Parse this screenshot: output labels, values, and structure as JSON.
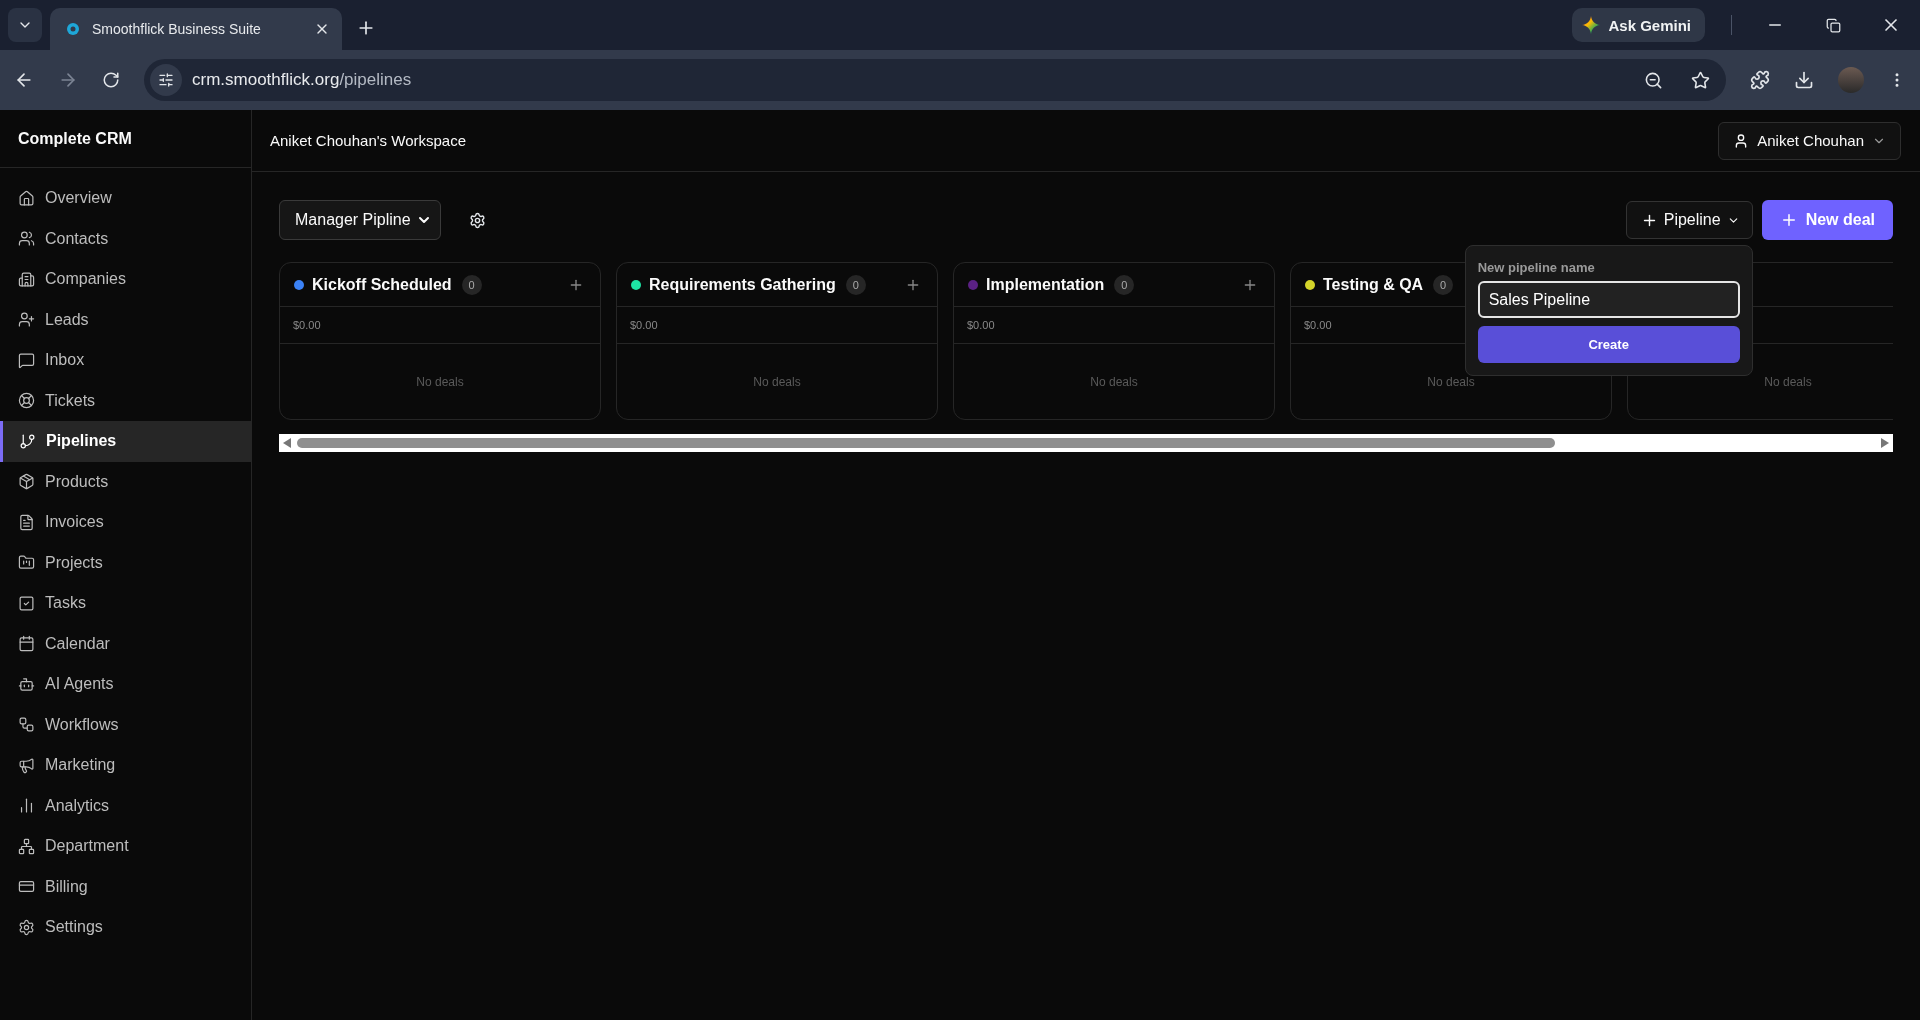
{
  "browser": {
    "tab_title": "Smoothflick Business Suite",
    "url_host": "crm.smoothflick.org",
    "url_path": "/pipelines",
    "gemini": "Ask Gemini"
  },
  "sidebar": {
    "brand": "Complete CRM",
    "items": [
      {
        "label": "Overview",
        "selected": false
      },
      {
        "label": "Contacts",
        "selected": false
      },
      {
        "label": "Companies",
        "selected": false
      },
      {
        "label": "Leads",
        "selected": false
      },
      {
        "label": "Inbox",
        "selected": false
      },
      {
        "label": "Tickets",
        "selected": false
      },
      {
        "label": "Pipelines",
        "selected": true
      },
      {
        "label": "Products",
        "selected": false
      },
      {
        "label": "Invoices",
        "selected": false
      },
      {
        "label": "Projects",
        "selected": false
      },
      {
        "label": "Tasks",
        "selected": false
      },
      {
        "label": "Calendar",
        "selected": false
      },
      {
        "label": "AI Agents",
        "selected": false
      },
      {
        "label": "Workflows",
        "selected": false
      },
      {
        "label": "Marketing",
        "selected": false
      },
      {
        "label": "Analytics",
        "selected": false
      },
      {
        "label": "Department",
        "selected": false
      },
      {
        "label": "Billing",
        "selected": false
      },
      {
        "label": "Settings",
        "selected": false
      }
    ]
  },
  "header": {
    "workspace": "Aniket Chouhan's Workspace",
    "user": "Aniket Chouhan"
  },
  "toolbar": {
    "pipeline_select": "Manager Pipline",
    "pipeline_button": "Pipeline",
    "new_deal_button": "New deal"
  },
  "columns": [
    {
      "name": "Kickoff Scheduled",
      "color": "#3b82f6",
      "add_button": true,
      "count": "0",
      "total": "$0.00",
      "empty_text": "No deals"
    },
    {
      "name": "Requirements Gathering",
      "color": "#1ee3a4",
      "add_button": true,
      "count": "0",
      "total": "$0.00",
      "empty_text": "No deals"
    },
    {
      "name": "Implementation",
      "color": "#5b2184",
      "add_button": true,
      "count": "0",
      "total": "$0.00",
      "empty_text": "No deals"
    },
    {
      "name": "Testing & QA",
      "color": "#d4d42a",
      "count": "0",
      "total": "$0.00",
      "empty_text": "No deals"
    },
    {
      "empty_text": "No deals"
    }
  ],
  "popup": {
    "label": "New pipeline name",
    "value": "Sales Pipeline",
    "button": "Create"
  }
}
